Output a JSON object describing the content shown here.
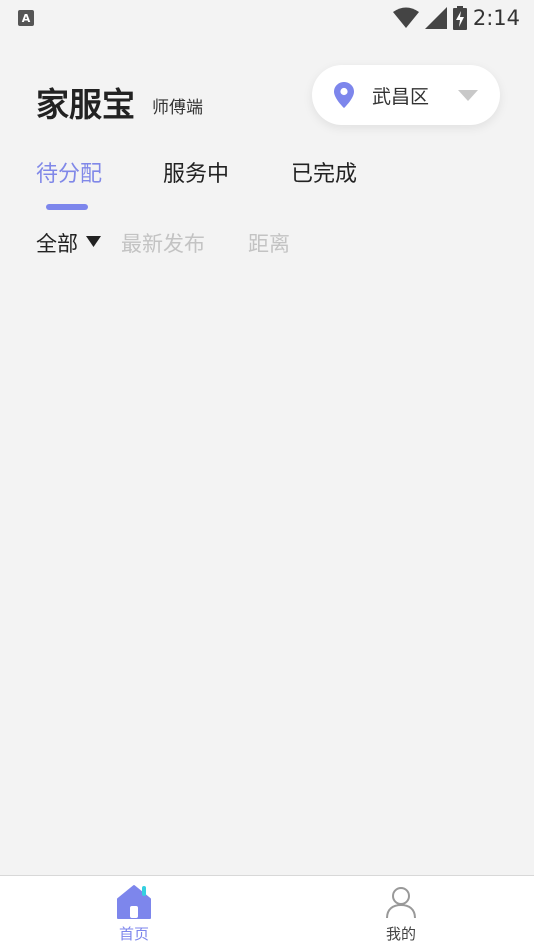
{
  "status_bar": {
    "notification_icon": "A",
    "time": "2:14",
    "icons": [
      "wifi-icon",
      "signal-icon",
      "battery-charging-icon"
    ]
  },
  "header": {
    "title": "家服宝",
    "subtitle": "师傅端",
    "location": {
      "icon": "location-pin-icon",
      "district": "武昌区",
      "dropdown_icon": "caret-down-icon"
    }
  },
  "tabs": [
    {
      "label": "待分配",
      "active": true
    },
    {
      "label": "服务中",
      "active": false
    },
    {
      "label": "已完成",
      "active": false
    }
  ],
  "filters": {
    "all": "全部",
    "latest": "最新发布",
    "distance": "距离"
  },
  "bottom_nav": [
    {
      "label": "首页",
      "icon": "home-icon",
      "active": true
    },
    {
      "label": "我的",
      "icon": "user-icon",
      "active": false
    }
  ],
  "colors": {
    "accent": "#7d86ec",
    "background": "#f3f3f3",
    "inactive_text": "#c3c3c3"
  }
}
